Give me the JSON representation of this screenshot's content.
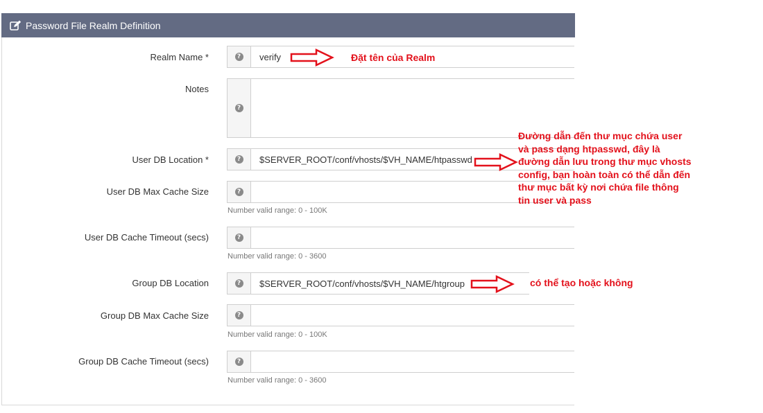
{
  "panel": {
    "title": "Password File Realm Definition",
    "icon": "edit-icon"
  },
  "fields": [
    {
      "label": "Realm Name *",
      "value": "verify",
      "hint": ""
    },
    {
      "label": "Notes",
      "value": "",
      "hint": ""
    },
    {
      "label": "User DB Location *",
      "value": "$SERVER_ROOT/conf/vhosts/$VH_NAME/htpasswd",
      "hint": ""
    },
    {
      "label": "User DB Max Cache Size",
      "value": "",
      "hint": "Number valid range: 0 - 100K"
    },
    {
      "label": "User DB Cache Timeout (secs)",
      "value": "",
      "hint": "Number valid range: 0 - 3600"
    },
    {
      "label": "Group DB Location",
      "value": "$SERVER_ROOT/conf/vhosts/$VH_NAME/htgroup",
      "hint": ""
    },
    {
      "label": "Group DB Max Cache Size",
      "value": "",
      "hint": "Number valid range: 0 - 100K"
    },
    {
      "label": "Group DB Cache Timeout (secs)",
      "value": "",
      "hint": "Number valid range: 0 - 3600"
    }
  ],
  "help_icon": "question-circle-icon",
  "annotations": {
    "realm_name": "Đặt tên của Realm",
    "user_db": [
      "Đường dẫn đến thư mục chứa user",
      "và pass dạng htpasswd, đây là",
      "đường dẫn lưu trong thư mục vhosts",
      "config, bạn hoàn toàn có thể dẫn đến",
      "thư mục bất kỳ nơi chứa file thông",
      "tin user và pass"
    ],
    "group_db": "có thể tạo hoặc không"
  },
  "colors": {
    "header_bg": "#636b83",
    "annotation": "#e3111b"
  }
}
